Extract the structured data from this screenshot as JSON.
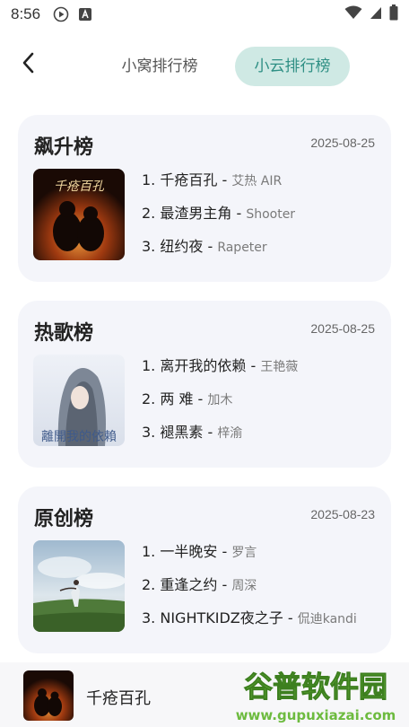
{
  "status": {
    "time": "8:56"
  },
  "tabs": [
    {
      "label": "小窝排行榜"
    },
    {
      "label": "小云排行榜"
    }
  ],
  "cards": [
    {
      "title": "飙升榜",
      "date": "2025-08-25",
      "cover_text": "千疮百孔",
      "songs": [
        {
          "title": "1. 千疮百孔",
          "sep": " - ",
          "artist": "艾热 AIR"
        },
        {
          "title": "2. 最渣男主角",
          "sep": " - ",
          "artist": "Shooter"
        },
        {
          "title": "3. 纽约夜",
          "sep": " - ",
          "artist": "Rapeter"
        }
      ]
    },
    {
      "title": "热歌榜",
      "date": "2025-08-25",
      "cover_text": "離開我的依賴",
      "songs": [
        {
          "title": "1. 离开我的依赖",
          "sep": " - ",
          "artist": "王艳薇"
        },
        {
          "title": "2. 两 难",
          "sep": " - ",
          "artist": "加木"
        },
        {
          "title": "3. 褪黑素",
          "sep": " - ",
          "artist": "梓渝"
        }
      ]
    },
    {
      "title": "原创榜",
      "date": "2025-08-23",
      "songs": [
        {
          "title": "1. 一半晚安",
          "sep": " - ",
          "artist": "罗言"
        },
        {
          "title": "2. 重逢之约",
          "sep": " - ",
          "artist": "周深"
        },
        {
          "title": "3. NIGHTKIDZ夜之子",
          "sep": " - ",
          "artist": "侃迪kandi"
        }
      ]
    }
  ],
  "player": {
    "title": "千疮百孔"
  },
  "watermark": {
    "text": "谷普软件园",
    "url": "www.gupuxiazai.com"
  },
  "colors": {
    "accent": "#2e8f84",
    "accent_bg": "#cfe9e4",
    "card_bg": "#f4f5fa"
  }
}
